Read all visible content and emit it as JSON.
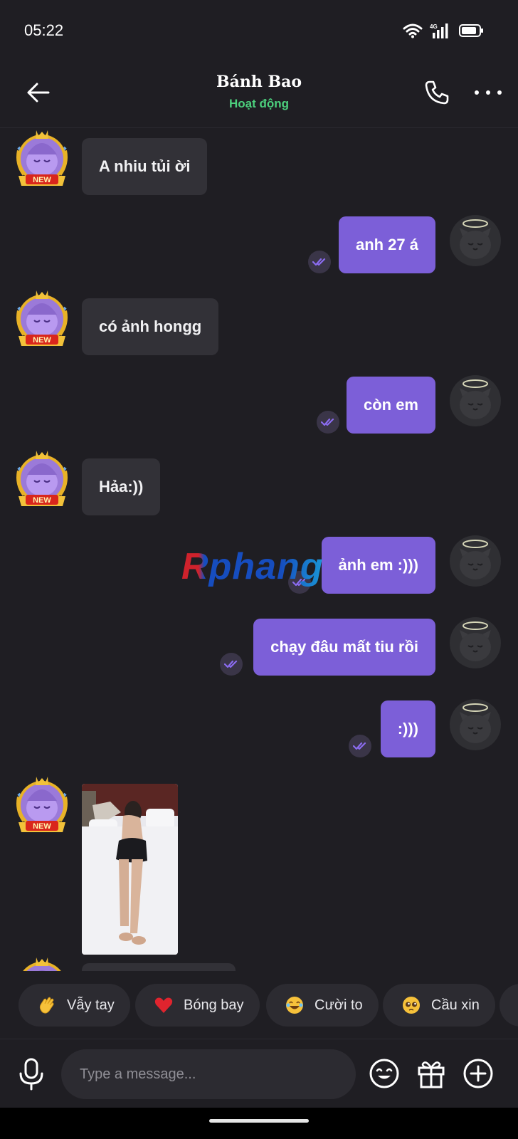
{
  "status_bar": {
    "time": "05:22",
    "network": "4G"
  },
  "header": {
    "title": "Bánh Bao",
    "status": "Hoạt động"
  },
  "messages": [
    {
      "side": "in",
      "text": "A nhiu tủi ời"
    },
    {
      "side": "out",
      "text": "anh 27 á",
      "read": true
    },
    {
      "side": "in",
      "text": "có ảnh hongg"
    },
    {
      "side": "out",
      "text": "còn em",
      "read": true
    },
    {
      "side": "in",
      "text": "Hảa:))"
    },
    {
      "side": "out",
      "text": "ảnh em :)))",
      "read": true
    },
    {
      "side": "out",
      "text": "chạy đâu mất tiu rồi",
      "read": true
    },
    {
      "side": "out",
      "text": ":)))",
      "read": true
    },
    {
      "side": "in",
      "type": "image"
    }
  ],
  "avatar_badge": "NEW",
  "watermark": "Rphang",
  "quick_replies": [
    {
      "emoji": "wave-emoji",
      "label": "Vẫy tay"
    },
    {
      "emoji": "heart-emoji",
      "label": "Bóng bay"
    },
    {
      "emoji": "laugh-emoji",
      "label": "Cười to"
    },
    {
      "emoji": "pleading-emoji",
      "label": "Cầu xin"
    }
  ],
  "input": {
    "placeholder": "Type a message..."
  },
  "colors": {
    "background": "#1f1e23",
    "outgoing_bubble": "#7c5fd8",
    "incoming_bubble": "#323137",
    "online_status": "#4cd07d"
  }
}
